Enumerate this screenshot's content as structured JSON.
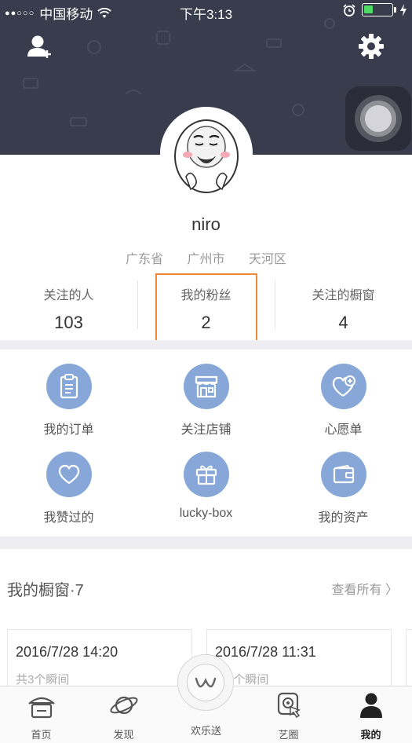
{
  "status_bar": {
    "signal": "●●○○○",
    "carrier": "中国移动",
    "time": "下午3:13"
  },
  "profile": {
    "username": "niro",
    "location": [
      "广东省",
      "广州市",
      "天河区"
    ]
  },
  "stats": [
    {
      "label": "关注的人",
      "count": "103"
    },
    {
      "label": "我的粉丝",
      "count": "2"
    },
    {
      "label": "关注的橱窗",
      "count": "4"
    }
  ],
  "menu": [
    {
      "label": "我的订单",
      "icon": "clipboard-icon"
    },
    {
      "label": "关注店铺",
      "icon": "shop-icon"
    },
    {
      "label": "心愿单",
      "icon": "heart-plus-icon"
    },
    {
      "label": "我赞过的",
      "icon": "heart-icon"
    },
    {
      "label": "lucky-box",
      "icon": "gift-box-icon"
    },
    {
      "label": "我的资产",
      "icon": "wallet-icon"
    }
  ],
  "my_windows": {
    "title": "我的橱窗·7",
    "view_all": "查看所有 〉",
    "cards": [
      {
        "time": "2016/7/28 14:20",
        "moments": "共3个瞬间"
      },
      {
        "time": "2016/7/28 11:31",
        "moments": "共2个瞬间"
      }
    ]
  },
  "tabbar": {
    "tabs": [
      {
        "label": "首页",
        "icon": "home-icon"
      },
      {
        "label": "发现",
        "icon": "planet-icon"
      },
      {
        "label": "欢乐送",
        "icon": "w-logo-icon"
      },
      {
        "label": "艺圈",
        "icon": "touch-circle-icon"
      },
      {
        "label": "我的",
        "icon": "user-icon"
      }
    ],
    "active": "我的"
  },
  "colors": {
    "header_bg": "#383c4c",
    "icon_circle": "#87a7d8",
    "highlight": "#f0883a",
    "battery": "#4cd964"
  }
}
